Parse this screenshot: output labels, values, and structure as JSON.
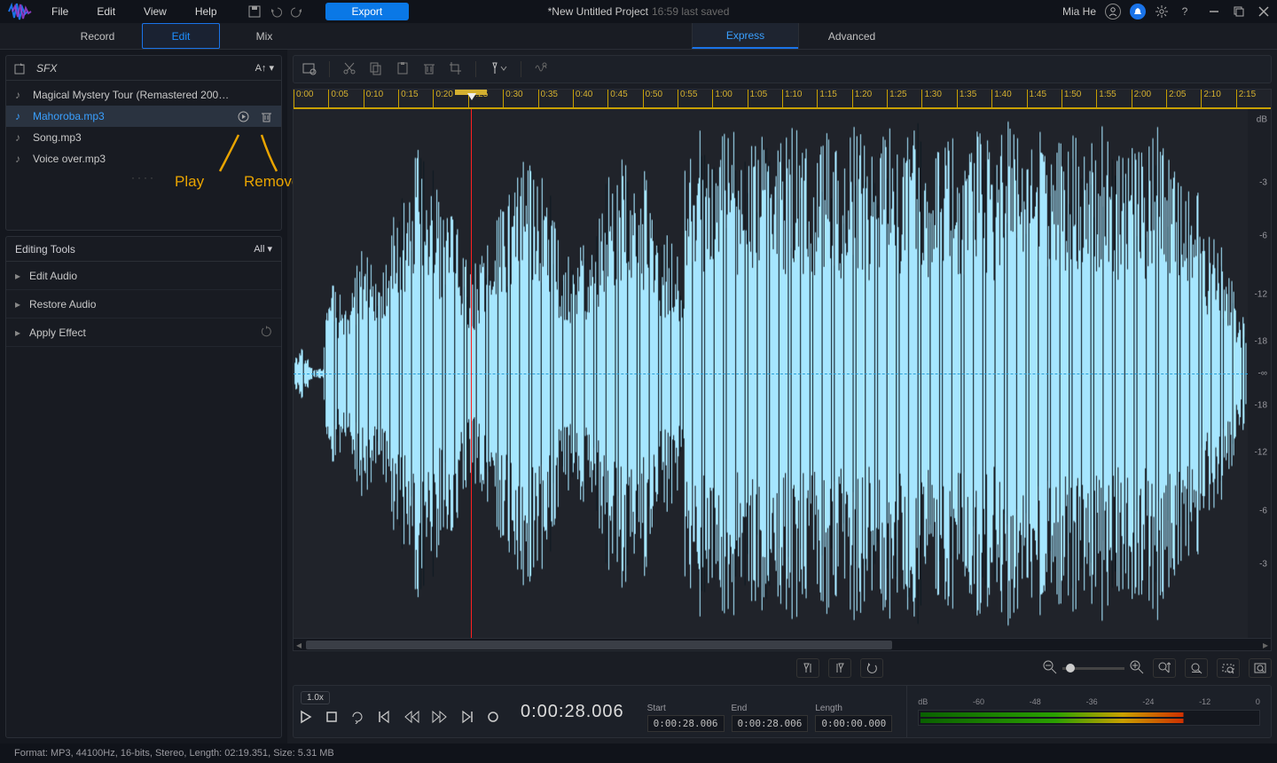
{
  "menu": {
    "file": "File",
    "edit": "Edit",
    "view": "View",
    "help": "Help"
  },
  "export_label": "Export",
  "title": "*New Untitled Project",
  "saved": "16:59 last saved",
  "user": "Mia He",
  "modes": {
    "record": "Record",
    "edit": "Edit",
    "mix": "Mix"
  },
  "subtabs": {
    "express": "Express",
    "advanced": "Advanced"
  },
  "library": {
    "header": "SFX",
    "sort": "A↑",
    "files": [
      {
        "name": "Magical Mystery Tour (Remastered 200…",
        "selected": false
      },
      {
        "name": "Mahoroba.mp3",
        "selected": true
      },
      {
        "name": "Song.mp3",
        "selected": false
      },
      {
        "name": "Voice over.mp3",
        "selected": false
      }
    ]
  },
  "annotations": {
    "play": "Play",
    "remove": "Remove"
  },
  "editing_tools": {
    "title": "Editing Tools",
    "filter": "All",
    "items": [
      "Edit Audio",
      "Restore Audio",
      "Apply Effect"
    ]
  },
  "ruler_ticks": [
    "0:00",
    "0:05",
    "0:10",
    "0:15",
    "0:20",
    "0:25",
    "0:30",
    "0:35",
    "0:40",
    "0:45",
    "0:50",
    "0:55",
    "1:00",
    "1:05",
    "1:10",
    "1:15",
    "1:20",
    "1:25",
    "1:30",
    "1:35",
    "1:40",
    "1:45",
    "1:50",
    "1:55",
    "2:00",
    "2:05",
    "2:10",
    "2:15"
  ],
  "db_title": "dB",
  "db_labels": [
    "-3",
    "-6",
    "-12",
    "-18",
    "-∞",
    "-18",
    "-12",
    "-6",
    "-3"
  ],
  "transport": {
    "speed": "1.0x",
    "timecode": "0:00:28.006",
    "start_label": "Start",
    "start": "0:00:28.006",
    "end_label": "End",
    "end": "0:00:28.006",
    "length_label": "Length",
    "length": "0:00:00.000"
  },
  "meter_scale": [
    "dB",
    "-60",
    "-48",
    "-36",
    "-24",
    "-12",
    "0"
  ],
  "status": "Format: MP3, 44100Hz, 16-bits, Stereo, Length: 02:19.351, Size: 5.31 MB"
}
